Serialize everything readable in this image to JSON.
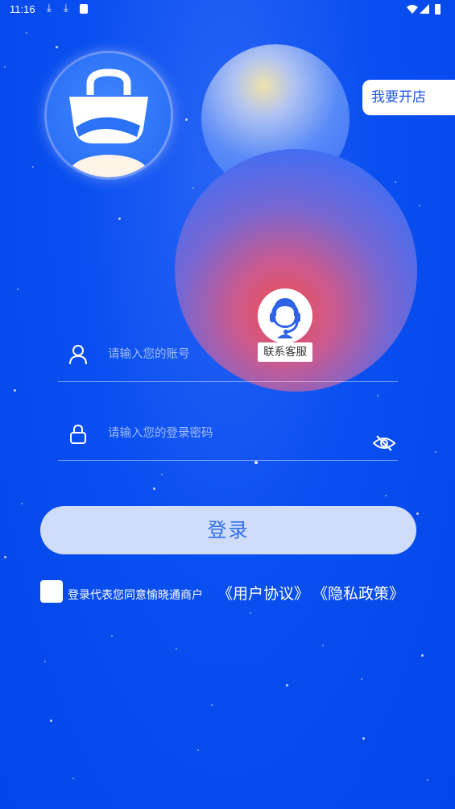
{
  "status_bar": {
    "time": "11:16",
    "icons": [
      "download-icon",
      "download-icon",
      "sim-icon",
      "wifi-icon",
      "signal-icon",
      "battery-icon"
    ]
  },
  "logo": {
    "icon": "shopping-bag-icon"
  },
  "open_shop_label": "我要开店",
  "support": {
    "label": "联系客服",
    "icon": "customer-service-icon"
  },
  "login_form": {
    "account_placeholder": "请输入您的账号",
    "password_placeholder": "请输入您的登录密码",
    "login_button": "登录"
  },
  "agreement": {
    "text": "登录代表您同意愉晓通商户",
    "user_agreement": "《用户协议》",
    "privacy_policy": "《隐私政策》",
    "checked": false
  },
  "colors": {
    "background": "#0a4ff0",
    "button_bg": "#cfdcfa",
    "button_text": "#2f6ef0",
    "accent": "#1e55e6"
  }
}
